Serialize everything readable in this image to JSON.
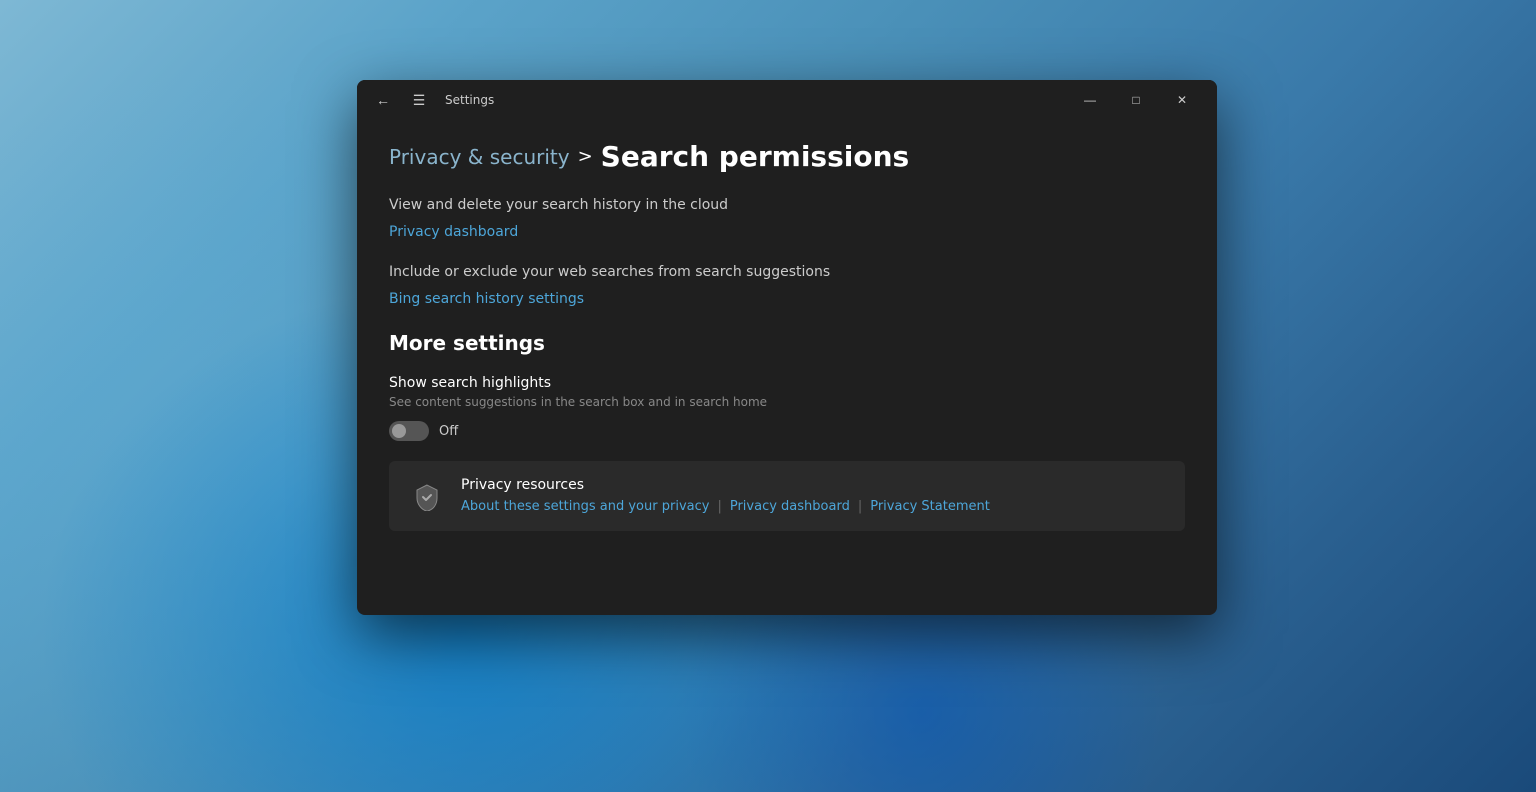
{
  "wallpaper": {
    "description": "Windows 11 blue bloom wallpaper"
  },
  "window": {
    "title": "Settings",
    "titlebar": {
      "back_label": "←",
      "menu_label": "☰",
      "title": "Settings"
    },
    "controls": {
      "minimize": "—",
      "maximize": "□",
      "close": "✕"
    }
  },
  "breadcrumb": {
    "parent": "Privacy & security",
    "chevron": ">",
    "current": "Search permissions"
  },
  "cloud_section": {
    "description": "View and delete your search history in the cloud",
    "link_label": "Privacy dashboard"
  },
  "suggestions_section": {
    "description": "Include or exclude your web searches from search suggestions",
    "link_label": "Bing search history settings"
  },
  "more_settings": {
    "heading": "More settings",
    "search_highlights": {
      "title": "Show search highlights",
      "subtitle": "See content suggestions in the search box and in search home",
      "toggle_state": "off",
      "toggle_label": "Off"
    }
  },
  "privacy_resources": {
    "title": "Privacy resources",
    "links": [
      {
        "label": "About these settings and your privacy",
        "id": "about-privacy-link"
      },
      {
        "label": "Privacy dashboard",
        "id": "privacy-dashboard-link"
      },
      {
        "label": "Privacy Statement",
        "id": "privacy-statement-link"
      }
    ],
    "separator": "|"
  }
}
